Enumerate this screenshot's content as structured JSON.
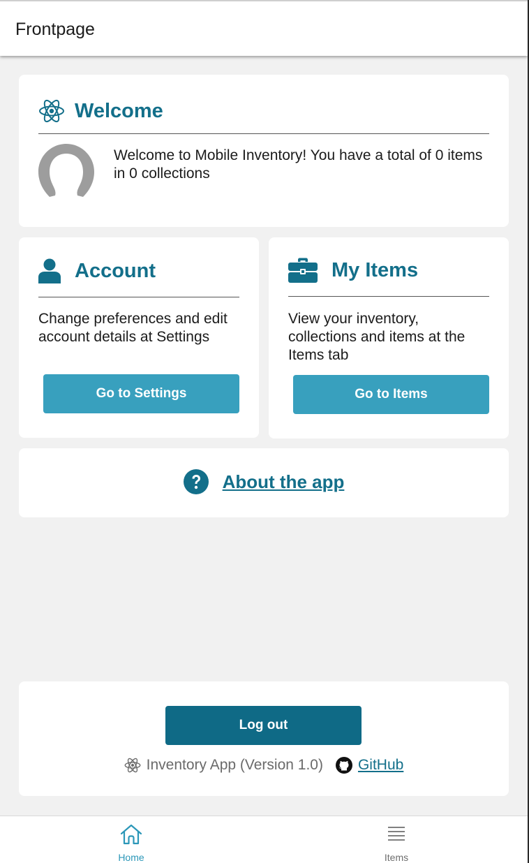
{
  "appbar": {
    "title": "Frontpage"
  },
  "welcome": {
    "title": "Welcome",
    "icon": "react-atom-icon",
    "message": "Welcome to Mobile Inventory! You have a total of 0 items in 0 collections"
  },
  "account": {
    "title": "Account",
    "icon": "user-icon",
    "body": "Change preferences and edit account details at Settings",
    "button_label": "Go to Settings"
  },
  "items": {
    "title": "My Items",
    "icon": "briefcase-icon",
    "body": "View your inventory, collections and items at the Items tab",
    "button_label": "Go to Items"
  },
  "about": {
    "icon": "question-circle-icon",
    "link_label": "About the app"
  },
  "footer": {
    "logout_label": "Log out",
    "version_text": "Inventory App (Version 1.0)",
    "github_label": "GitHub"
  },
  "tabbar": {
    "tabs": [
      {
        "label": "Home",
        "icon": "home-icon",
        "active": true
      },
      {
        "label": "Items",
        "icon": "list-icon",
        "active": false
      }
    ]
  },
  "colors": {
    "accent": "#136f8a",
    "button": "#38a0be",
    "logout_button": "#0f6a86",
    "active_tab": "#2b97b8",
    "background": "#f1f1f1"
  }
}
